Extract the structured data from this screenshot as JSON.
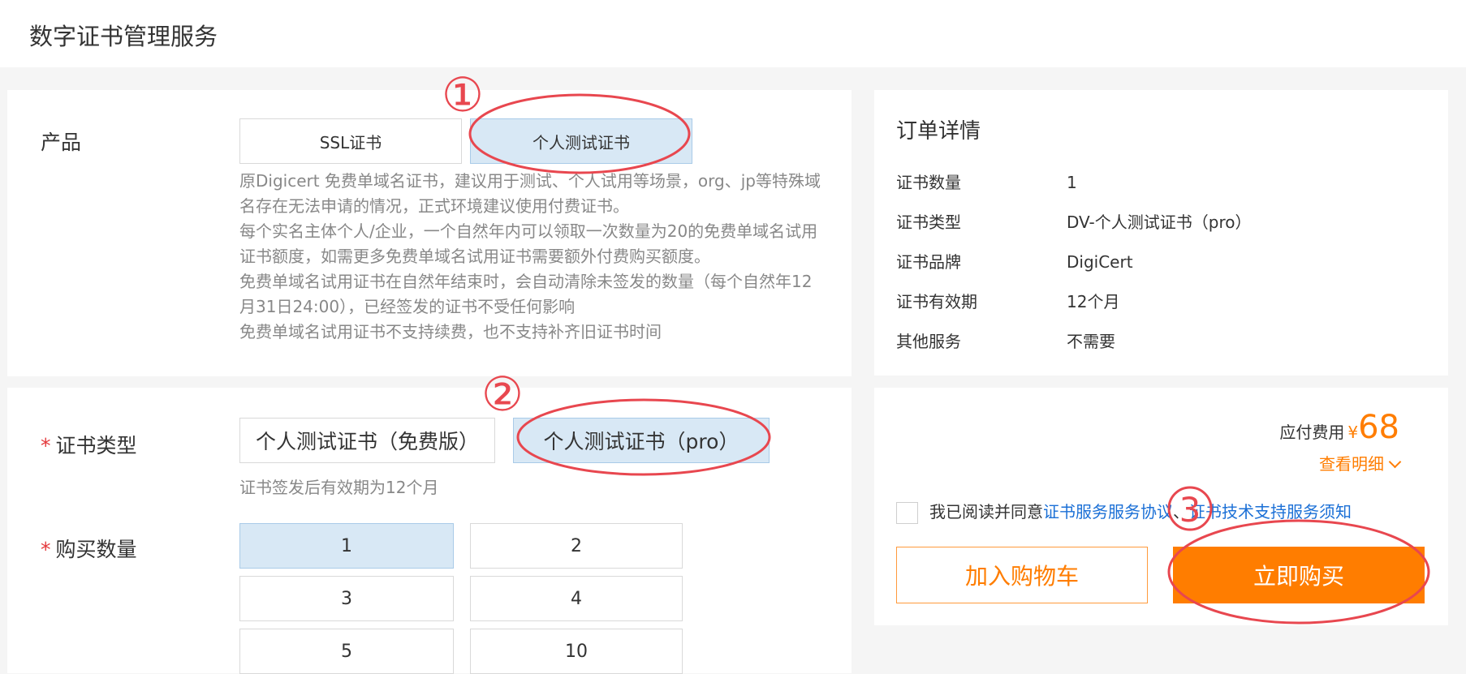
{
  "header": {
    "title": "数字证书管理服务"
  },
  "product": {
    "label": "产品",
    "options": [
      "SSL证书",
      "个人测试证书"
    ],
    "description": [
      "原Digicert 免费单域名证书，建议用于测试、个人试用等场景，org、jp等特殊域名存在无法申请的情况，正式环境建议使用付费证书。",
      "每个实名主体个人/企业，一个自然年内可以领取一次数量为20的免费单域名试用证书额度，如需更多免费单域名试用证书需要额外付费购买额度。",
      "免费单域名试用证书在自然年结束时，会自动清除未签发的数量（每个自然年12月31日24:00），已经签发的证书不受任何影响",
      "免费单域名试用证书不支持续费，也不支持补齐旧证书时间"
    ]
  },
  "cert_type": {
    "required_mark": "*",
    "label": "证书类型",
    "options": [
      "个人测试证书（免费版）",
      "个人测试证书（pro）"
    ],
    "hint": "证书签发后有效期为12个月"
  },
  "quantity": {
    "required_mark": "*",
    "label": "购买数量",
    "options": [
      "1",
      "2",
      "3",
      "4",
      "5",
      "10"
    ]
  },
  "order": {
    "title": "订单详情",
    "rows": [
      {
        "k": "证书数量",
        "v": "1"
      },
      {
        "k": "证书类型",
        "v": "DV-个人测试证书（pro）"
      },
      {
        "k": "证书品牌",
        "v": "DigiCert"
      },
      {
        "k": "证书有效期",
        "v": "12个月"
      },
      {
        "k": "其他服务",
        "v": "不需要"
      }
    ]
  },
  "pay": {
    "fee_label": "应付费用",
    "currency": "¥",
    "amount": "68",
    "detail_link": "查看明细",
    "agree_prefix": "我已阅读并同意",
    "agree_link1": "证书服务服务协议",
    "agree_sep": "、",
    "agree_link2": "证书技术支持服务须知",
    "cart_button": "加入购物车",
    "buy_button": "立即购买"
  },
  "annotations": {
    "marks": [
      "①",
      "②",
      "3"
    ],
    "color": "#e8474f"
  },
  "colors": {
    "accent": "#ff7d00",
    "selected_bg": "#d8e8f5",
    "link": "#1a6fd6",
    "required": "#e4393c"
  }
}
